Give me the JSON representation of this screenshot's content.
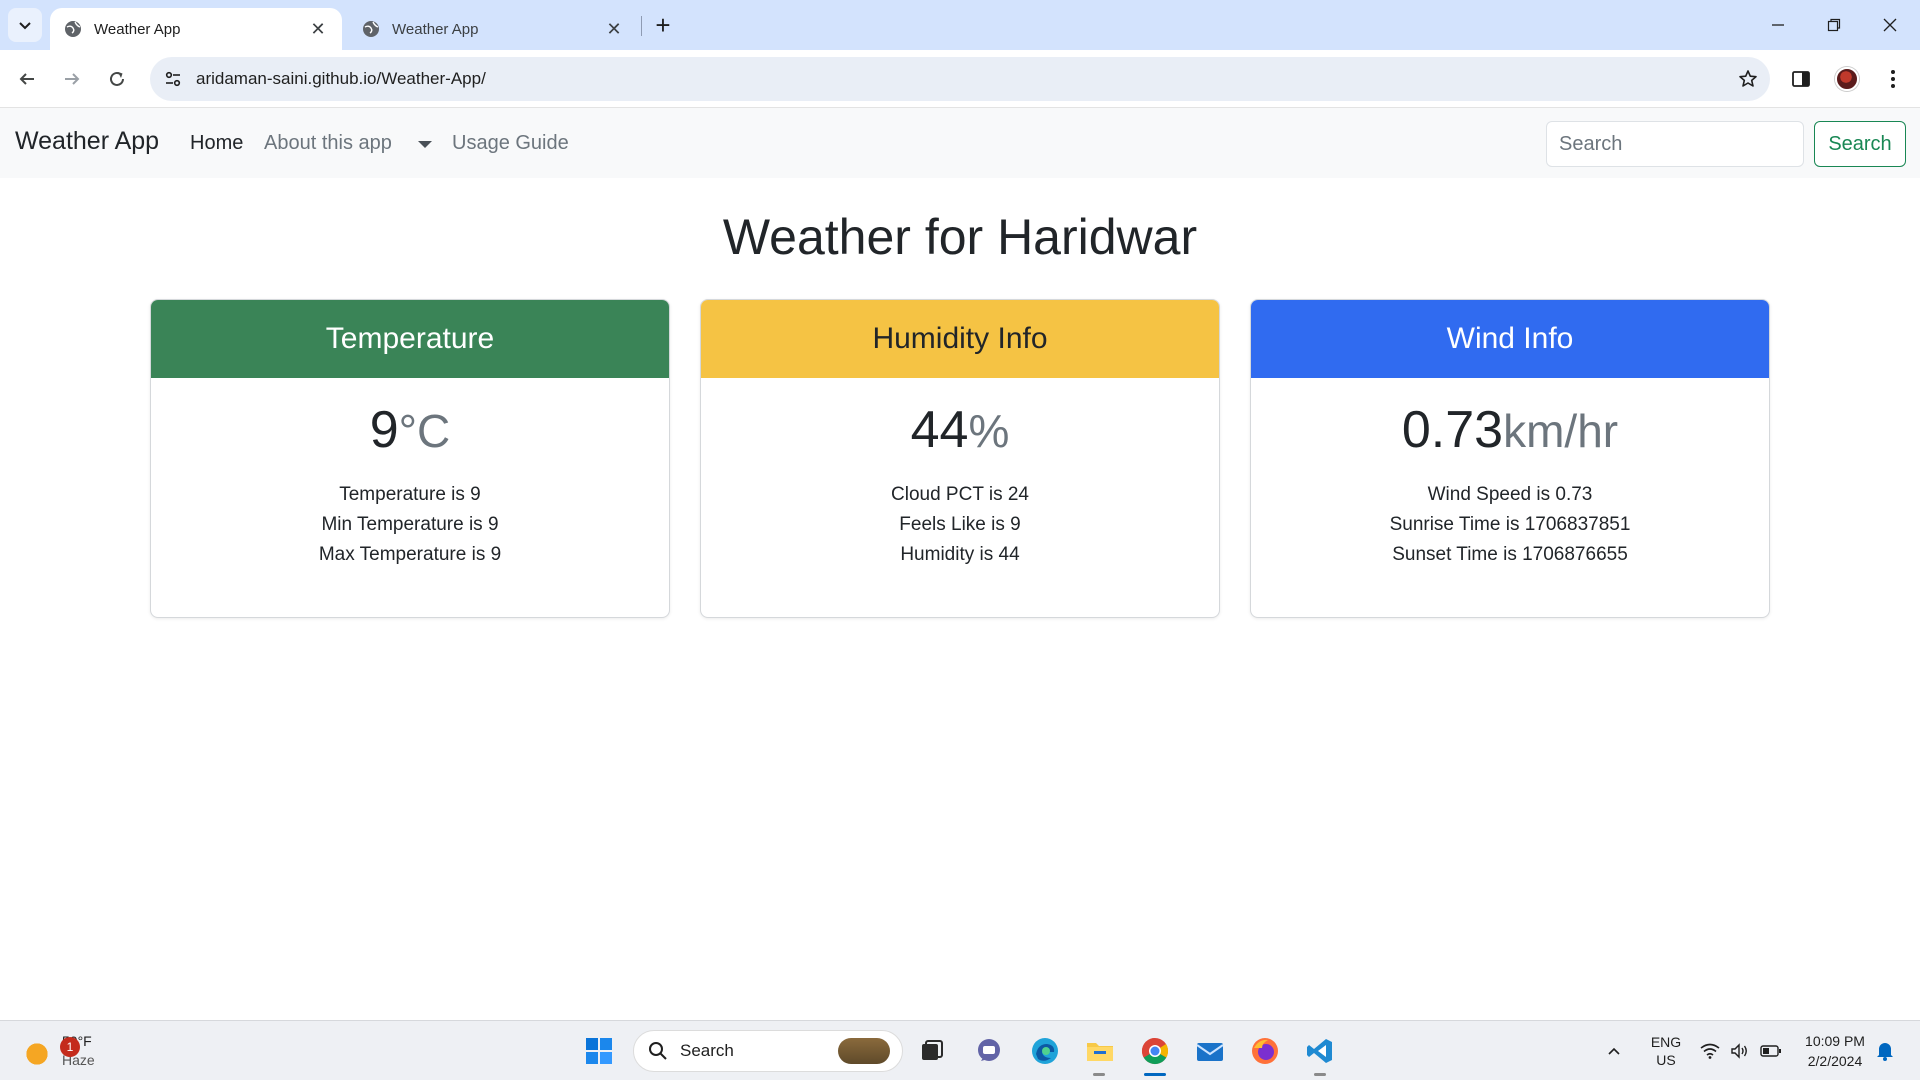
{
  "browser": {
    "tabs": [
      {
        "title": "Weather App",
        "active": true
      },
      {
        "title": "Weather App",
        "active": false
      }
    ],
    "url": "aridaman-saini.github.io/Weather-App/"
  },
  "navbar": {
    "brand": "Weather App",
    "links": [
      {
        "label": "Home",
        "active": true
      },
      {
        "label": "About this app",
        "active": false
      },
      {
        "label": "Usage Guide",
        "active": false
      }
    ],
    "search_placeholder": "Search",
    "search_button": "Search"
  },
  "page": {
    "title": "Weather for Haridwar"
  },
  "cards": {
    "temperature": {
      "header": "Temperature",
      "header_color": "#3a8457",
      "header_text_color": "#ffffff",
      "value": "9",
      "unit": "°C",
      "details": [
        "Temperature is 9",
        "Min Temperature is 9",
        "Max Temperature is 9"
      ]
    },
    "humidity": {
      "header": "Humidity Info",
      "header_color": "#f5c344",
      "header_text_color": "#212529",
      "value": "44",
      "unit": "%",
      "details": [
        "Cloud PCT is 24",
        "Feels Like is 9",
        "Humidity is 44"
      ]
    },
    "wind": {
      "header": "Wind Info",
      "header_color": "#306bf0",
      "header_text_color": "#ffffff",
      "value": "0.73",
      "unit": "km/hr",
      "details": [
        "Wind Speed is 0.73",
        "Sunrise Time is 1706837851",
        "Sunset Time is 1706876655"
      ]
    }
  },
  "taskbar": {
    "weather": {
      "temp": "50°F",
      "condition": "Haze",
      "badge": "1"
    },
    "search_label": "Search",
    "language": {
      "lang": "ENG",
      "region": "US"
    },
    "clock": {
      "time": "10:09 PM",
      "date": "2/2/2024"
    },
    "icons": [
      "start-icon",
      "search-icon",
      "task-view-icon",
      "teams-chat-icon",
      "edge-icon",
      "file-explorer-icon",
      "chrome-icon",
      "mail-icon",
      "firefox-icon",
      "vscode-icon"
    ]
  }
}
